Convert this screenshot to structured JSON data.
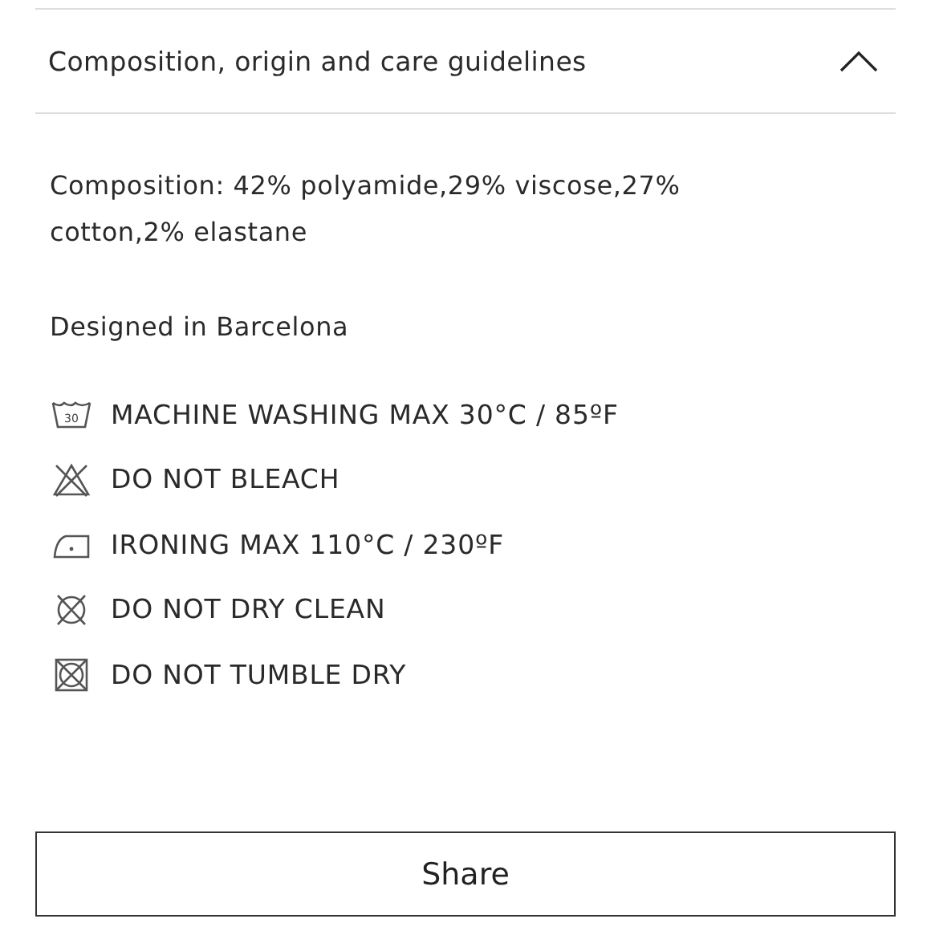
{
  "section": {
    "title": "Composition, origin and care guidelines",
    "expanded": true,
    "composition": "Composition: 42%  polyamide,29%  viscose,27%  cotton,2%  elastane",
    "origin": "Designed in Barcelona",
    "care": [
      {
        "kind": "wash",
        "icon_label": "30",
        "text": "MACHINE WASHING MAX 30°C / 85ºF"
      },
      {
        "kind": "no-bleach",
        "text": "DO NOT BLEACH"
      },
      {
        "kind": "iron",
        "text": "IRONING MAX 110°C / 230ºF"
      },
      {
        "kind": "no-dry-clean",
        "text": "DO NOT DRY CLEAN"
      },
      {
        "kind": "no-tumble-dry",
        "text": "DO NOT TUMBLE DRY"
      }
    ]
  },
  "share_button": "Share"
}
